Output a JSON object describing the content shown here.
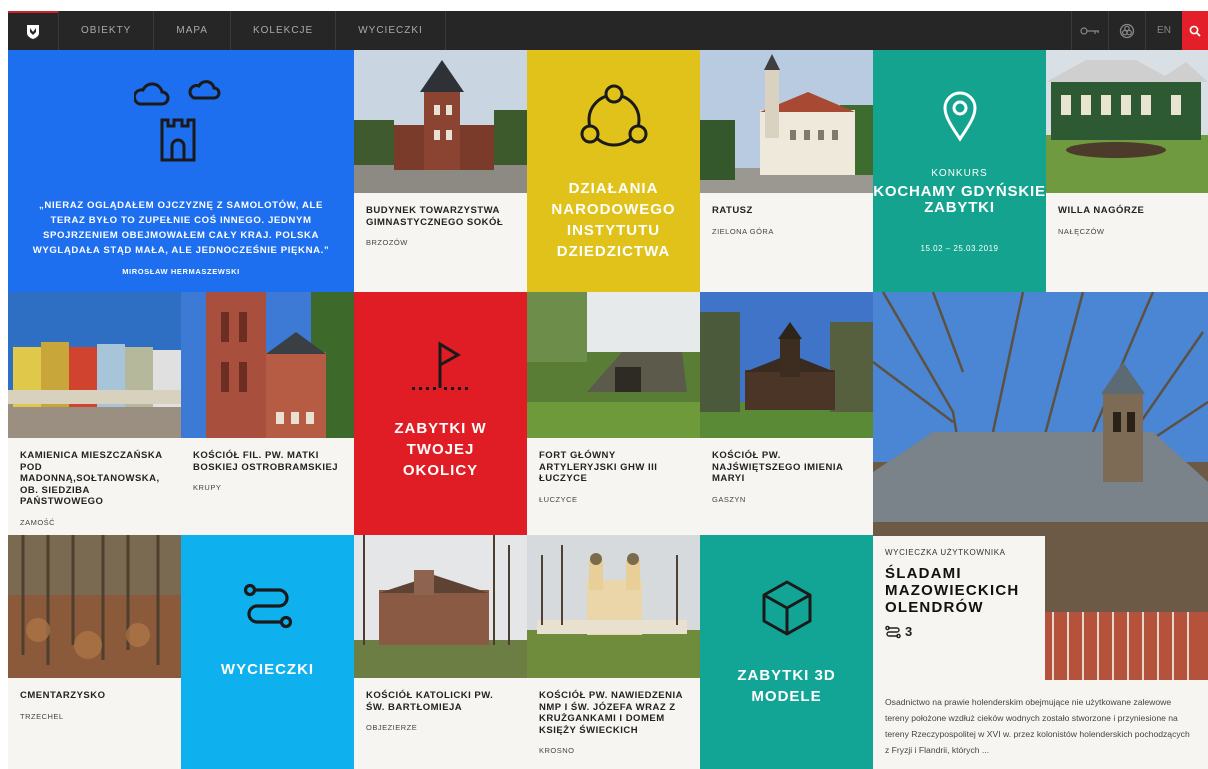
{
  "nav": {
    "items": [
      "OBIEKTY",
      "MAPA",
      "KOLEKCJE",
      "WYCIECZKI"
    ],
    "lang": "EN",
    "icons": [
      "key-icon",
      "triquetra-icon",
      "search-icon"
    ]
  },
  "colors": {
    "blue": "#1d6ff0",
    "yellow": "#e0c21a",
    "teal": "#14a38e",
    "red": "#e01d24",
    "cyan": "#0fb0ee",
    "teal2": "#12a596",
    "nav": "#262626",
    "accent": "#e3202a"
  },
  "quote": {
    "text": "„NIERAZ OGLĄDAŁEM OJCZYZNĘ Z SAMOLOTÓW, ALE TERAZ BYŁO TO ZUPEŁNIE COŚ INNEGO. JEDNYM SPOJRZENIEM OBEJMOWAŁEM CAŁY KRAJ. POLSKA WYGLĄDAŁA STĄD MAŁA, ALE JEDNOCZEŚNIE PIĘKNA.”",
    "author": "MIROSŁAW HERMASZEWSKI"
  },
  "tiles": {
    "sokol": {
      "title": "BUDYNEK TOWARZYSTWA GIMNASTYCZNEGO SOKÓŁ",
      "loc": "BRZOZÓW"
    },
    "dzialania": {
      "title": "DZIAŁANIA NARODOWEGO INSTYTUTU DZIEDZICTWA"
    },
    "ratusz": {
      "title": "RATUSZ",
      "loc": "ZIELONA GÓRA"
    },
    "konkurs": {
      "label": "KONKURS",
      "title": "KOCHAMY GDYŃSKIE ZABYTKI",
      "date": "15.02 – 25.03.2019"
    },
    "willa": {
      "title": "WILLA NAGÓRZE",
      "loc": "NAŁĘCZÓW"
    },
    "kamienica": {
      "title": "KAMIENICA MIESZCZAŃSKA POD MADONNĄ,SOŁTANOWSKA, OB. SIEDZIBA PAŃSTWOWEGO",
      "loc": "ZAMOŚĆ"
    },
    "krupy": {
      "title": "KOŚCIÓŁ FIL. PW. MATKI BOSKIEJ OSTROBRAMSKIEJ",
      "loc": "KRUPY"
    },
    "okolicy": {
      "title": "ZABYTKI W TWOJEJ OKOLICY"
    },
    "fort": {
      "title": "FORT GŁÓWNY ARTYLERYJSKI GHW III ŁUCZYCE",
      "loc": "ŁUCZYCE"
    },
    "gaszyn": {
      "title": "KOŚCIÓŁ PW. NAJŚWIĘTSZEGO IMIENIA MARYI",
      "loc": "GASZYN"
    },
    "cmentarzysko": {
      "title": "CMENTARZYSKO",
      "loc": "TRZECHEL"
    },
    "wycieczki": {
      "title": "WYCIECZKI"
    },
    "obiezierze": {
      "title": "KOŚCIÓŁ KATOLICKI PW. ŚW. BARTŁOMIEJA",
      "loc": "OBJEZIERZE"
    },
    "krosno": {
      "title": "KOŚCIÓŁ PW. NAWIEDZENIA NMP I ŚW. JÓZEFA WRAZ Z KRUŻGANKAMI I DOMEM KSIĘŻY ŚWIECKICH",
      "loc": "KROSNO"
    },
    "modele": {
      "title": "ZABYTKI 3D MODELE"
    },
    "sladami": {
      "label": "WYCIECZKA UŻYTKOWNIKA",
      "title": "ŚLADAMI MAZOWIECKICH OLENDRÓW",
      "count": "3",
      "desc": "Osadnictwo na prawie holenderskim obejmujące nie użytkowane zalewowe tereny położone wzdłuż cieków wodnych zostało stworzone i przyniesione na tereny Rzeczypospolitej w XVI w. przez kolonistów holenderskich pochodzących z Fryzji i Flandrii, których ..."
    }
  }
}
